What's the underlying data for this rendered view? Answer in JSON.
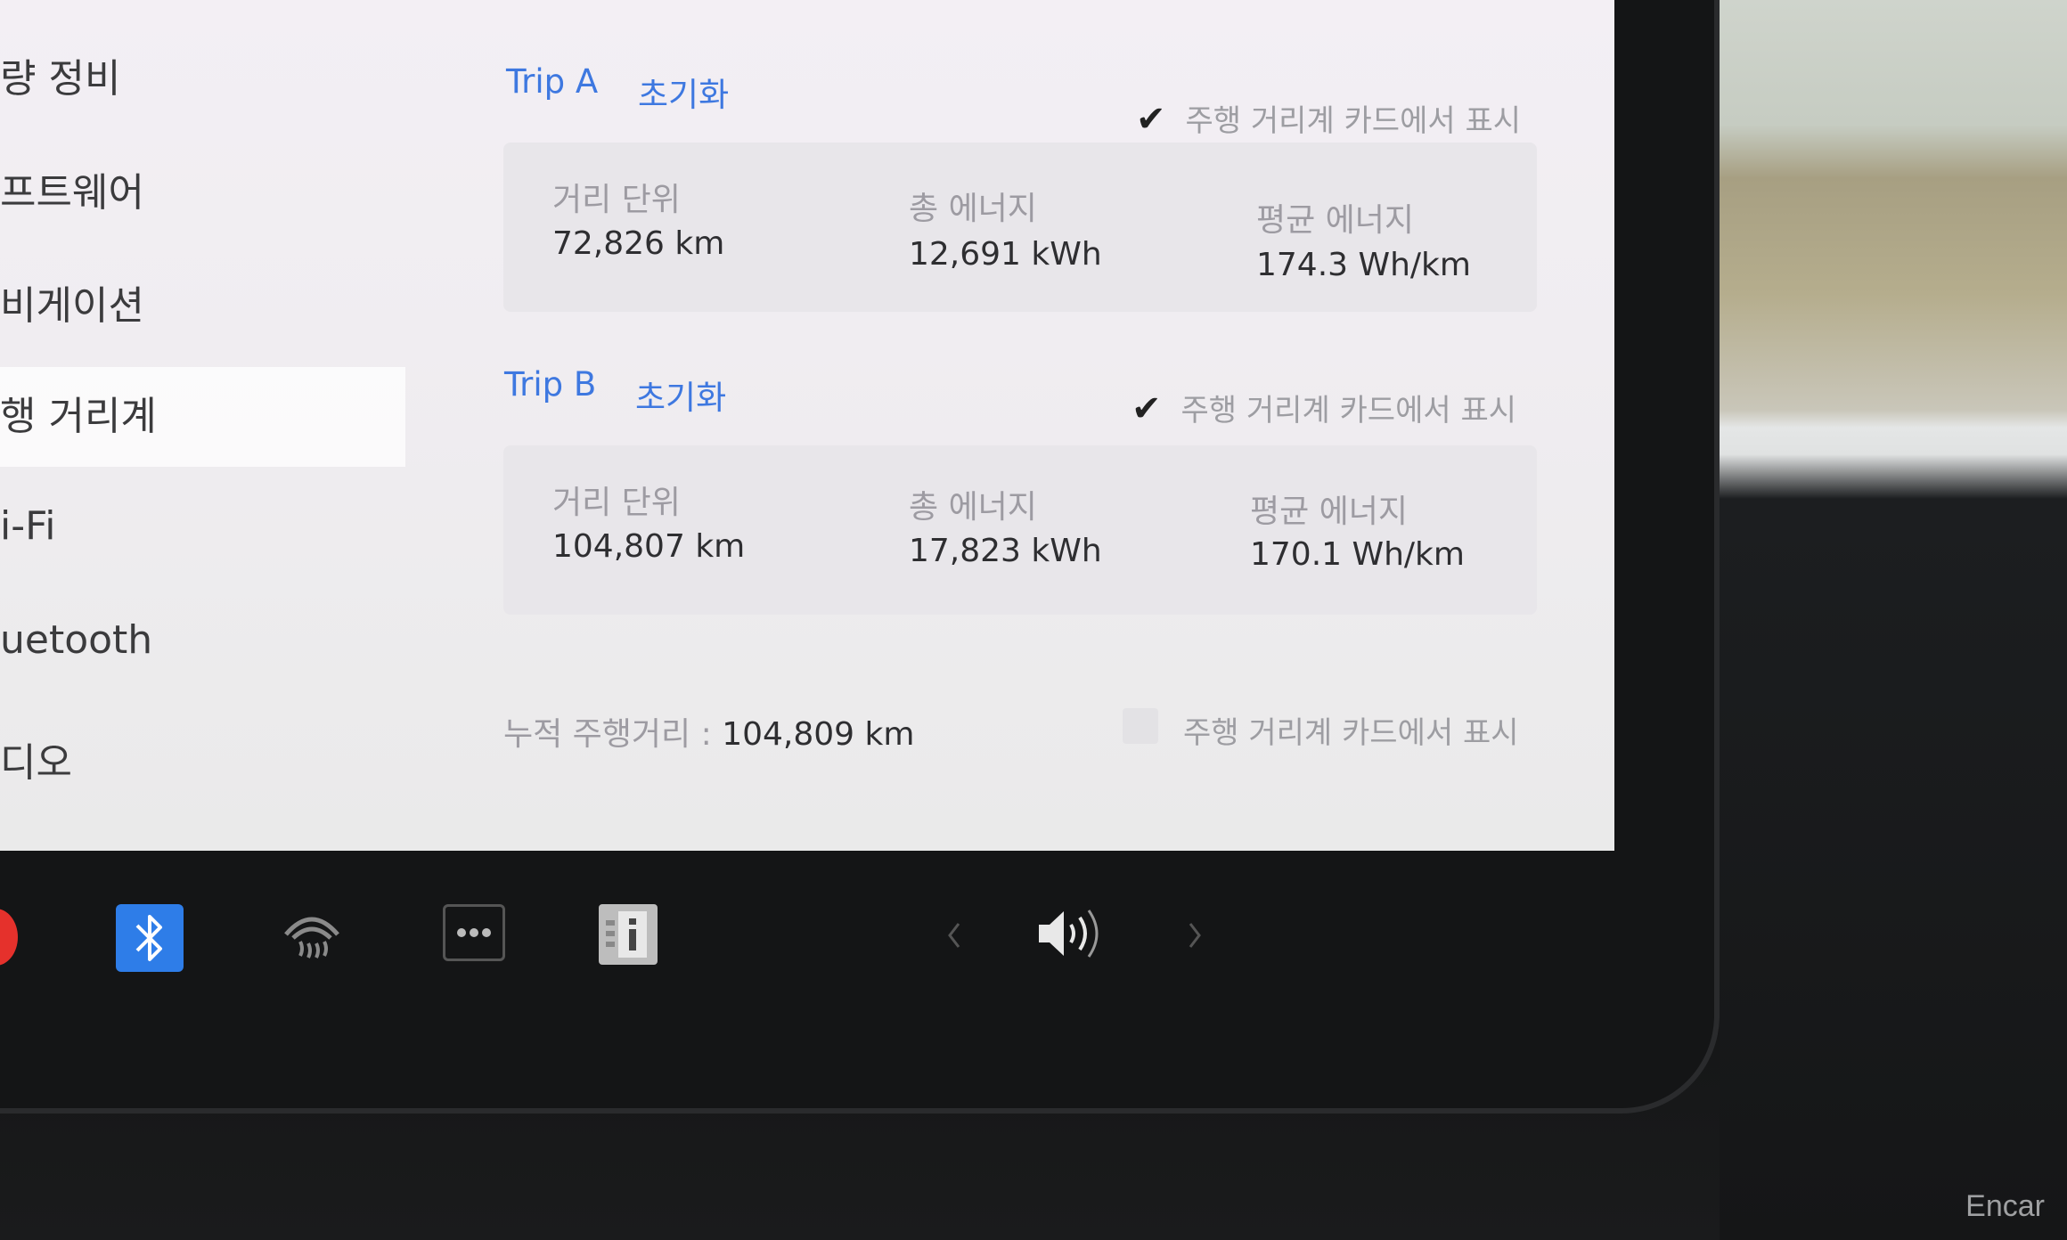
{
  "sidebar": {
    "items": [
      {
        "label": "량 정비"
      },
      {
        "label": "프트웨어"
      },
      {
        "label": "비게이션"
      },
      {
        "label": "행 거리계"
      },
      {
        "label": "i-Fi"
      },
      {
        "label": "uetooth"
      },
      {
        "label": "디오"
      }
    ]
  },
  "trip_a": {
    "title": "Trip A",
    "reset": "초기화",
    "show_label": "주행 거리계 카드에서 표시",
    "distance_label": "거리 단위",
    "distance_value": "72,826 km",
    "energy_label": "총 에너지",
    "energy_value": "12,691 kWh",
    "avg_label": "평균 에너지",
    "avg_value": "174.3 Wh/km"
  },
  "trip_b": {
    "title": "Trip B",
    "reset": "초기화",
    "show_label": "주행 거리계 카드에서 표시",
    "distance_label": "거리 단위",
    "distance_value": "104,807 km",
    "energy_label": "총 에너지",
    "energy_value": "17,823 kWh",
    "avg_label": "평균 에너지",
    "avg_value": "170.1 Wh/km"
  },
  "odometer": {
    "label": "누적 주행거리 :",
    "value": "104,809 km",
    "show_label": "주행 거리계 카드에서 표시"
  },
  "taskbar": {
    "icons": [
      "bluetooth-icon",
      "rear-defrost-icon",
      "more-dots-icon",
      "info-icon",
      "chevron-left-icon",
      "volume-icon",
      "chevron-right-icon"
    ]
  },
  "watermark": "Encar",
  "colors": {
    "link_blue": "#3e78e0",
    "bluetooth_blue": "#2e7de8"
  }
}
